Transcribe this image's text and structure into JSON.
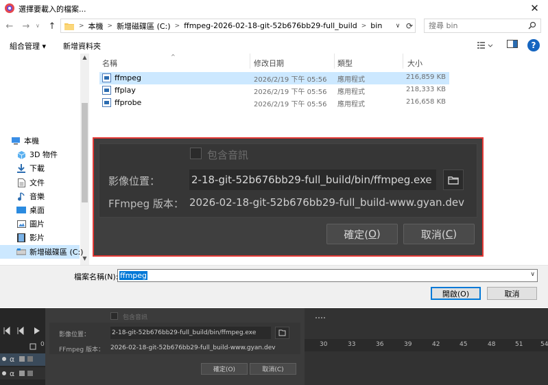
{
  "window": {
    "title": "選擇要載入的檔案...",
    "close_glyph": "✕"
  },
  "nav": {
    "back_glyph": "←",
    "forward_glyph": "→",
    "up_glyph": "↑"
  },
  "address": {
    "crumbs": [
      "本機",
      "新增磁碟區 (C:)",
      "ffmpeg-2026-02-18-git-52b676bb29-full_build",
      "bin"
    ],
    "separator": ">"
  },
  "search": {
    "placeholder": "搜尋 bin"
  },
  "toolbar": {
    "organize": "組合管理 ▾",
    "new_folder": "新增資料夾",
    "help": "?"
  },
  "sidebar": {
    "items": [
      {
        "label": "本機",
        "icon": "computer-icon"
      },
      {
        "label": "3D 物件",
        "icon": "3d-objects-icon"
      },
      {
        "label": "下載",
        "icon": "download-icon"
      },
      {
        "label": "文件",
        "icon": "document-icon"
      },
      {
        "label": "音樂",
        "icon": "music-icon"
      },
      {
        "label": "桌面",
        "icon": "desktop-icon"
      },
      {
        "label": "圖片",
        "icon": "pictures-icon"
      },
      {
        "label": "影片",
        "icon": "videos-icon"
      },
      {
        "label": "新增磁碟區 (C:)",
        "icon": "drive-icon"
      }
    ]
  },
  "columns": {
    "name": "名稱",
    "date": "修改日期",
    "type": "類型",
    "size": "大小"
  },
  "files": [
    {
      "name": "ffmpeg",
      "date": "2026/2/19 下午 05:56",
      "type": "應用程式",
      "size": "216,859 KB"
    },
    {
      "name": "ffplay",
      "date": "2026/2/19 下午 05:56",
      "type": "應用程式",
      "size": "218,333 KB"
    },
    {
      "name": "ffprobe",
      "date": "2026/2/19 下午 05:56",
      "type": "應用程式",
      "size": "216,658 KB"
    }
  ],
  "dark_dialog": {
    "include_audio": "包含音訊",
    "location_label": "影像位置：",
    "location_value": "2-18-git-52b676bb29-full_build/bin/ffmpeg.exe",
    "version_label": "FFmpeg 版本：",
    "version_value": "2026-02-18-git-52b676bb29-full_build-www.gyan.dev",
    "ok_prefix": "確定(",
    "ok_key": "O",
    "ok_suffix": ")",
    "cancel_prefix": "取消(",
    "cancel_key": "C",
    "cancel_suffix": ")"
  },
  "filename": {
    "label": "檔案名稱(N):",
    "value": "ffmpeg",
    "dropdown_glyph": "∨"
  },
  "buttons": {
    "open": "開啟(O)",
    "cancel": "取消"
  },
  "background_app": {
    "include_audio": "包含音訊",
    "location_label": "影像位置：",
    "location_value": "2-18-git-52b676bb29-full_build/bin/ffmpeg.exe",
    "version_label": "FFmpeg 版本：",
    "version_value": "2026-02-18-git-52b676bb29-full_build-www.gyan.dev",
    "ok": "確定(O)",
    "cancel": "取消(C)",
    "ruler_ticks": [
      "30",
      "33",
      "36",
      "39",
      "42",
      "45",
      "48",
      "51",
      "54"
    ],
    "left_zero": "0"
  },
  "colors": {
    "accent": "#0078d7",
    "highlight_border": "#e53935",
    "dialog_bg": "#3f3f3f"
  }
}
